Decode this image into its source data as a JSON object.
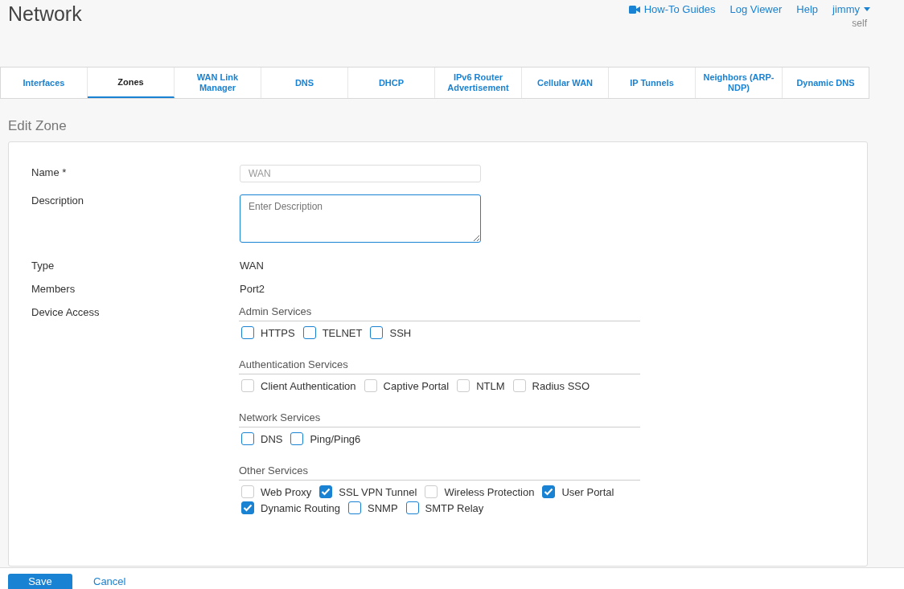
{
  "page": {
    "title": "Network"
  },
  "header_links": [
    {
      "label": "How-To Guides",
      "kind": "video"
    },
    {
      "label": "Log Viewer",
      "kind": "plain"
    },
    {
      "label": "Help",
      "kind": "plain"
    }
  ],
  "user": {
    "name": "jimmy",
    "role": "self"
  },
  "tabs": [
    {
      "label": "Interfaces",
      "selected": false
    },
    {
      "label": "Zones",
      "selected": true
    },
    {
      "label": "WAN Link Manager",
      "selected": false
    },
    {
      "label": "DNS",
      "selected": false
    },
    {
      "label": "DHCP",
      "selected": false
    },
    {
      "label": "IPv6 Router Advertisement",
      "selected": false
    },
    {
      "label": "Cellular WAN",
      "selected": false
    },
    {
      "label": "IP Tunnels",
      "selected": false
    },
    {
      "label": "Neighbors (ARP-NDP)",
      "selected": false
    },
    {
      "label": "Dynamic DNS",
      "selected": false
    }
  ],
  "form": {
    "title": "Edit Zone",
    "name": {
      "label": "Name *",
      "value": "WAN",
      "disabled": true
    },
    "description": {
      "label": "Description",
      "placeholder": "Enter Description"
    },
    "type": {
      "label": "Type",
      "value": "WAN"
    },
    "members": {
      "label": "Members",
      "value": "Port2"
    },
    "device_access": {
      "label": "Device Access",
      "groups": [
        {
          "title": "Admin Services",
          "options": [
            {
              "label": "HTTPS",
              "checked": false,
              "disabled": false
            },
            {
              "label": "TELNET",
              "checked": false,
              "disabled": false
            },
            {
              "label": "SSH",
              "checked": false,
              "disabled": false
            }
          ]
        },
        {
          "title": "Authentication Services",
          "options": [
            {
              "label": "Client Authentication",
              "checked": false,
              "disabled": true
            },
            {
              "label": "Captive Portal",
              "checked": false,
              "disabled": true
            },
            {
              "label": "NTLM",
              "checked": false,
              "disabled": true
            },
            {
              "label": "Radius SSO",
              "checked": false,
              "disabled": true
            }
          ]
        },
        {
          "title": "Network Services",
          "options": [
            {
              "label": "DNS",
              "checked": false,
              "disabled": false
            },
            {
              "label": "Ping/Ping6",
              "checked": false,
              "disabled": false
            }
          ]
        },
        {
          "title": "Other Services",
          "options": [
            {
              "label": "Web Proxy",
              "checked": false,
              "disabled": true
            },
            {
              "label": "SSL VPN Tunnel",
              "checked": true,
              "disabled": false
            },
            {
              "label": "Wireless Protection",
              "checked": false,
              "disabled": true
            },
            {
              "label": "User Portal",
              "checked": true,
              "disabled": false
            },
            {
              "label": "Dynamic Routing",
              "checked": true,
              "disabled": false
            },
            {
              "label": "SNMP",
              "checked": false,
              "disabled": false
            },
            {
              "label": "SMTP Relay",
              "checked": false,
              "disabled": false
            }
          ]
        }
      ]
    }
  },
  "buttons": [
    {
      "label": "Save",
      "kind": "primary"
    },
    {
      "label": "Cancel",
      "kind": "link"
    }
  ]
}
